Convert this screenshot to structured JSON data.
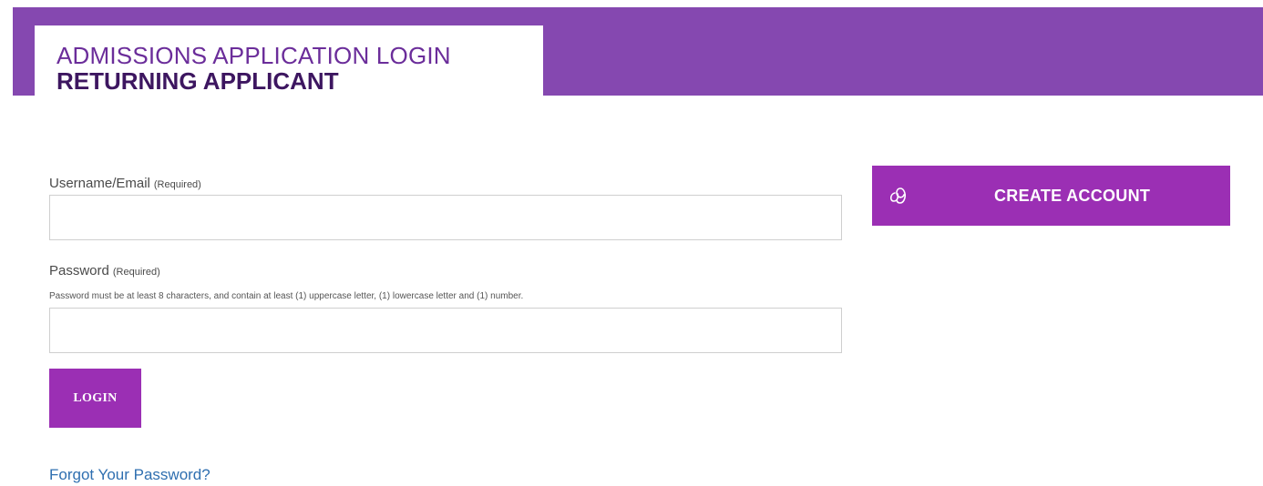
{
  "header": {
    "title_line1": "ADMISSIONS APPLICATION LOGIN",
    "title_line2": "RETURNING APPLICANT"
  },
  "form": {
    "username_label": "Username/Email",
    "username_required": "(Required)",
    "username_value": "",
    "password_label": "Password",
    "password_required": "(Required)",
    "password_hint": "Password must be at least 8 characters, and contain at least (1) uppercase letter, (1) lowercase letter and (1) number.",
    "password_value": "",
    "login_label": "LOGIN",
    "forgot_label": "Forgot Your Password?"
  },
  "create_account": {
    "label": "CREATE ACCOUNT",
    "icon": "link-icon"
  },
  "colors": {
    "banner": "#8548b0",
    "button": "#9b2fb4",
    "title_light": "#6b2d9a",
    "title_dark": "#3d1660",
    "link": "#2f6fb0"
  }
}
